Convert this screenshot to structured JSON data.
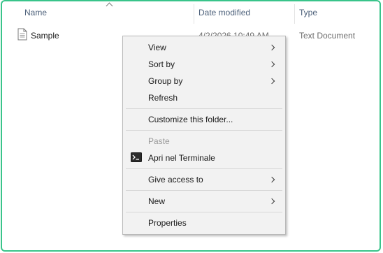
{
  "columns": {
    "name": "Name",
    "date_modified": "Date modified",
    "type": "Type"
  },
  "files": [
    {
      "name": "Sample",
      "date_modified": "4/2/2026 10:49 AM",
      "type": "Text Document",
      "icon": "text-file-icon"
    }
  ],
  "context_menu": {
    "items": [
      {
        "label": "View",
        "submenu": true
      },
      {
        "label": "Sort by",
        "submenu": true
      },
      {
        "label": "Group by",
        "submenu": true
      },
      {
        "label": "Refresh"
      },
      {
        "label": "Customize this folder..."
      },
      {
        "label": "Paste",
        "disabled": true
      },
      {
        "label": "Apri nel Terminale",
        "icon": "terminal-icon"
      },
      {
        "label": "Give access to",
        "submenu": true
      },
      {
        "label": "New",
        "submenu": true
      },
      {
        "label": "Properties"
      }
    ]
  },
  "colors": {
    "window_border": "#39c48a",
    "header_text": "#4c607a",
    "menu_bg": "#f2f2f2"
  }
}
